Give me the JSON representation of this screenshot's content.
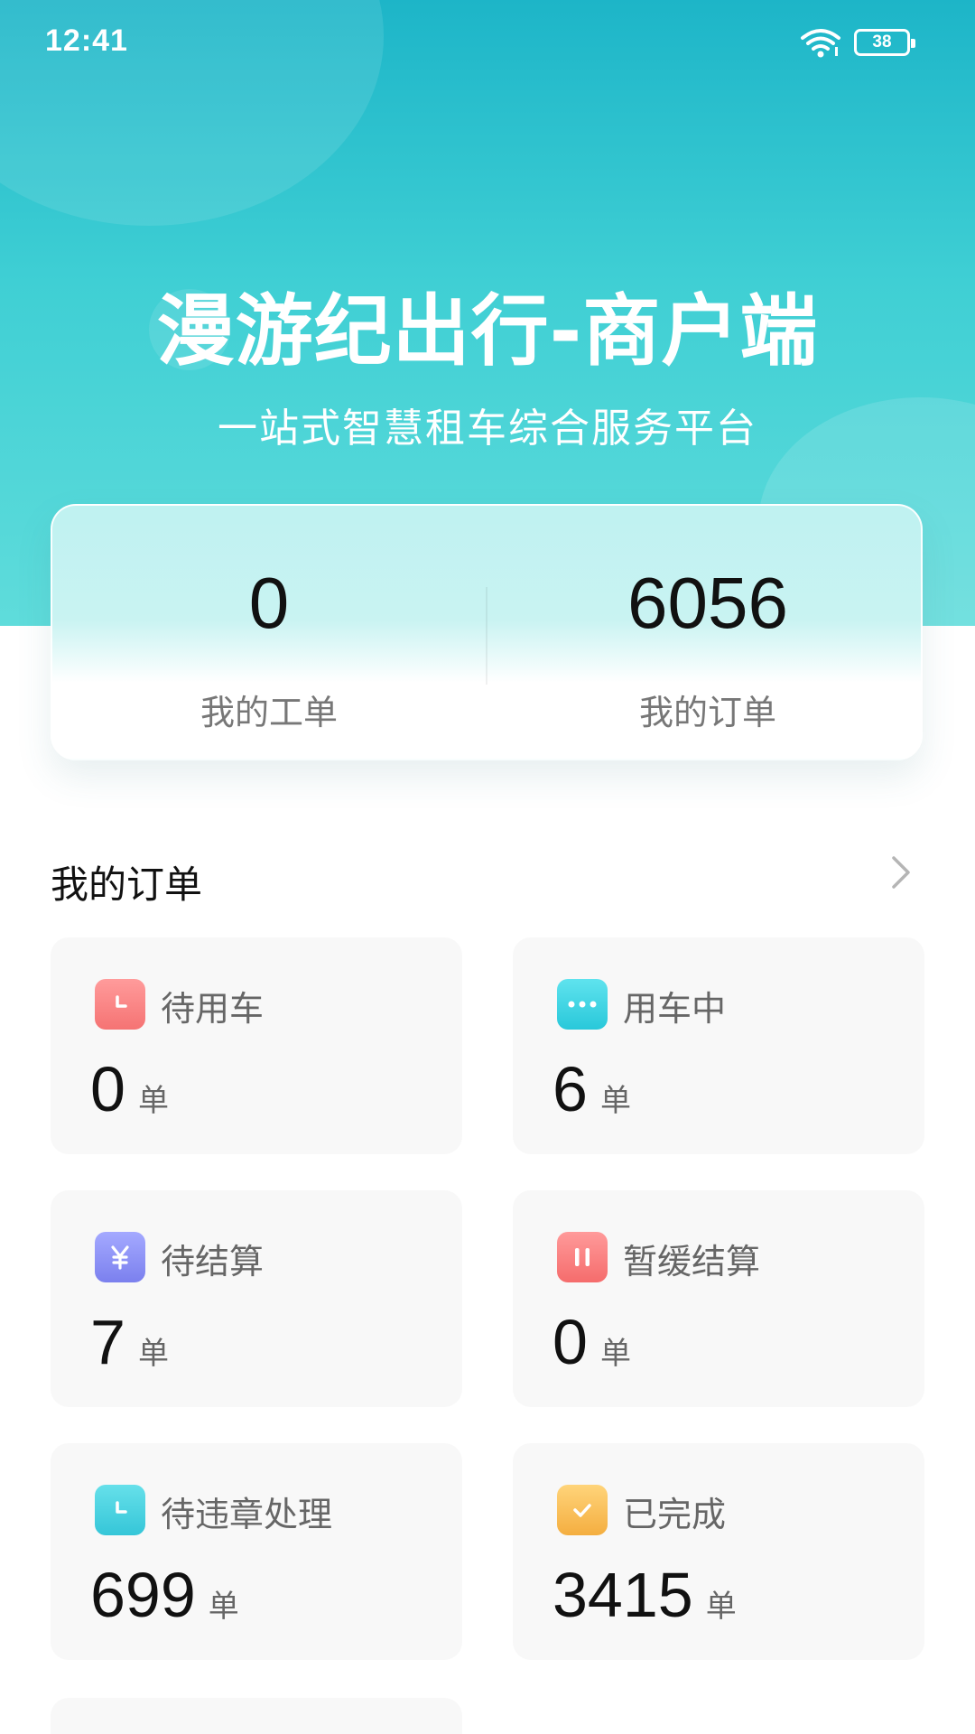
{
  "status_bar": {
    "time": "12:41",
    "battery": "38"
  },
  "header": {
    "title": "漫游纪出行-商户端",
    "subtitle": "一站式智慧租车综合服务平台"
  },
  "stats": [
    {
      "value": "0",
      "label": "我的工单"
    },
    {
      "value": "6056",
      "label": "我的订单"
    }
  ],
  "orders_section": {
    "title": "我的订单",
    "tiles": [
      {
        "label": "待用车",
        "value": "0",
        "unit": "单",
        "icon": "clock-icon",
        "color": "#f57373"
      },
      {
        "label": "用车中",
        "value": "6",
        "unit": "单",
        "icon": "more-dots-icon",
        "color": "#29c8da"
      },
      {
        "label": "待结算",
        "value": "7",
        "unit": "单",
        "icon": "yuan-icon",
        "color": "#7b80ee"
      },
      {
        "label": "暂缓结算",
        "value": "0",
        "unit": "单",
        "icon": "pause-icon",
        "color": "#f56c6c"
      },
      {
        "label": "待违章处理",
        "value": "699",
        "unit": "单",
        "icon": "clock-icon",
        "color": "#35c6d8"
      },
      {
        "label": "已完成",
        "value": "3415",
        "unit": "单",
        "icon": "check-icon",
        "color": "#f4ae40"
      }
    ]
  }
}
